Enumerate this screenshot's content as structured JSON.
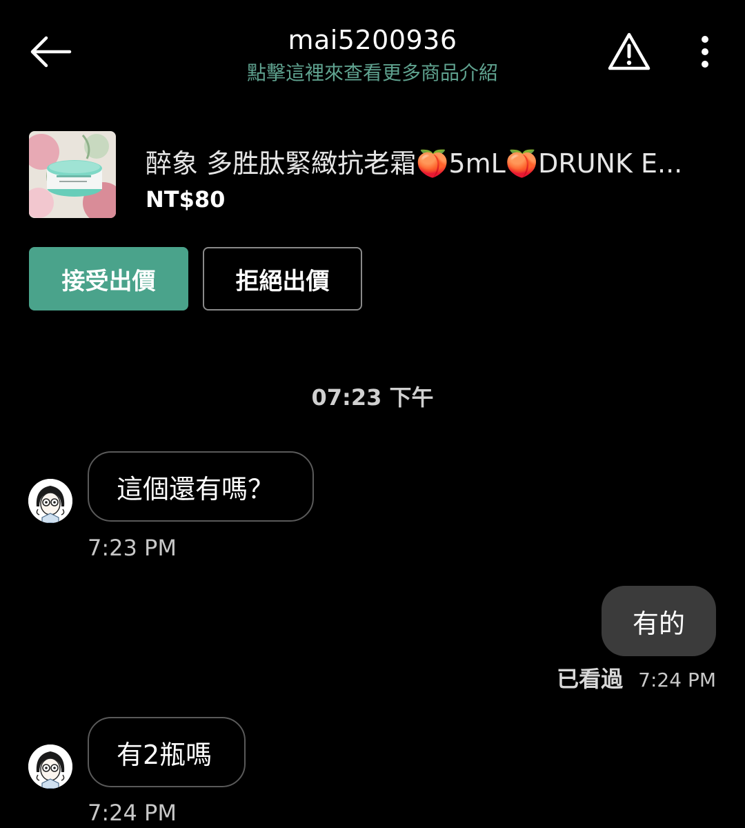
{
  "header": {
    "title": "mai5200936",
    "subtitle": "點擊這裡來查看更多商品介紹",
    "back_icon": "back-arrow-icon",
    "warning_icon": "warning-triangle-icon",
    "more_icon": "more-vertical-icon"
  },
  "product": {
    "name": "醉象 多胜肽緊緻抗老霜🍑5mL🍑DRUNK E...",
    "price": "NT$80"
  },
  "offer": {
    "accept_label": "接受出價",
    "decline_label": "拒絕出價",
    "accent_color": "#4aa38b"
  },
  "chat": {
    "date_separator": "07:23 下午",
    "messages": [
      {
        "direction": "in",
        "text": "這個還有嗎？",
        "time": "7:23 PM"
      },
      {
        "direction": "out",
        "text": "有的",
        "status": "已看過",
        "time": "7:24 PM"
      },
      {
        "direction": "in",
        "text": "有2瓶嗎",
        "time": "7:24 PM"
      }
    ]
  }
}
